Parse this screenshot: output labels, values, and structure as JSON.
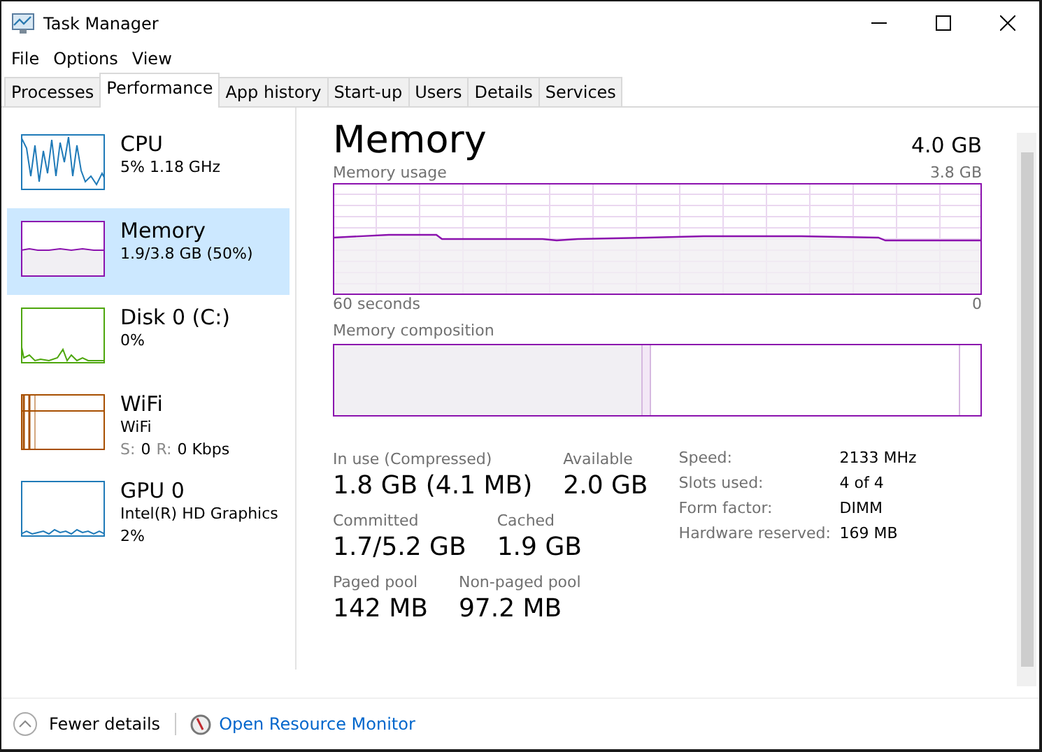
{
  "window": {
    "title": "Task Manager"
  },
  "menu": [
    "File",
    "Options",
    "View"
  ],
  "tabs": [
    {
      "label": "Processes",
      "selected": false
    },
    {
      "label": "Performance",
      "selected": true
    },
    {
      "label": "App history",
      "selected": false
    },
    {
      "label": "Start-up",
      "selected": false
    },
    {
      "label": "Users",
      "selected": false
    },
    {
      "label": "Details",
      "selected": false
    },
    {
      "label": "Services",
      "selected": false
    }
  ],
  "sidebar": {
    "items": [
      {
        "kind": "cpu",
        "title": "CPU",
        "color": "#1f7ab8",
        "selected": false,
        "lines": [
          [
            {
              "text": "5% 1.18 GHz",
              "muted": false
            }
          ]
        ]
      },
      {
        "kind": "memory",
        "title": "Memory",
        "color": "#8b12ae",
        "selected": true,
        "lines": [
          [
            {
              "text": "1.9/3.8 GB (50%)",
              "muted": false
            }
          ]
        ]
      },
      {
        "kind": "disk",
        "title": "Disk 0 (C:)",
        "color": "#4da60c",
        "selected": false,
        "lines": [
          [
            {
              "text": "0%",
              "muted": false
            }
          ]
        ]
      },
      {
        "kind": "network",
        "title": "WiFi",
        "color": "#a74f01",
        "selected": false,
        "lines": [
          [
            {
              "text": "WiFi",
              "muted": false
            }
          ],
          [
            {
              "text": "S:",
              "muted": true
            },
            {
              "text": "0",
              "muted": false
            },
            {
              "text": "R:",
              "muted": true
            },
            {
              "text": "0 Kbps",
              "muted": false
            }
          ]
        ]
      },
      {
        "kind": "gpu",
        "title": "GPU 0",
        "color": "#1f7ab8",
        "selected": false,
        "lines": [
          [
            {
              "text": "Intel(R) HD Graphics",
              "muted": false
            }
          ],
          [
            {
              "text": "2%",
              "muted": false
            }
          ]
        ]
      }
    ]
  },
  "detail": {
    "title": "Memory",
    "total": "4.0 GB",
    "usage_label": "Memory usage",
    "usage_max": "3.8 GB",
    "time_span": "60 seconds",
    "time_end": "0",
    "composition_label": "Memory composition",
    "stats": [
      [
        {
          "label": "In use (Compressed)",
          "value": "1.8 GB (4.1 MB)"
        },
        {
          "label": "Available",
          "value": "2.0 GB"
        }
      ],
      [
        {
          "label": "Committed",
          "value": "1.7/5.2 GB"
        },
        {
          "label": "Cached",
          "value": "1.9 GB"
        }
      ],
      [
        {
          "label": "Paged pool",
          "value": "142 MB"
        },
        {
          "label": "Non-paged pool",
          "value": "97.2 MB"
        }
      ]
    ],
    "properties": [
      {
        "label": "Speed:",
        "value": "2133 MHz"
      },
      {
        "label": "Slots used:",
        "value": "4 of 4"
      },
      {
        "label": "Form factor:",
        "value": "DIMM"
      },
      {
        "label": "Hardware reserved:",
        "value": "169 MB"
      }
    ]
  },
  "footer": {
    "toggle": "Fewer details",
    "link": "Open Resource Monitor"
  }
}
